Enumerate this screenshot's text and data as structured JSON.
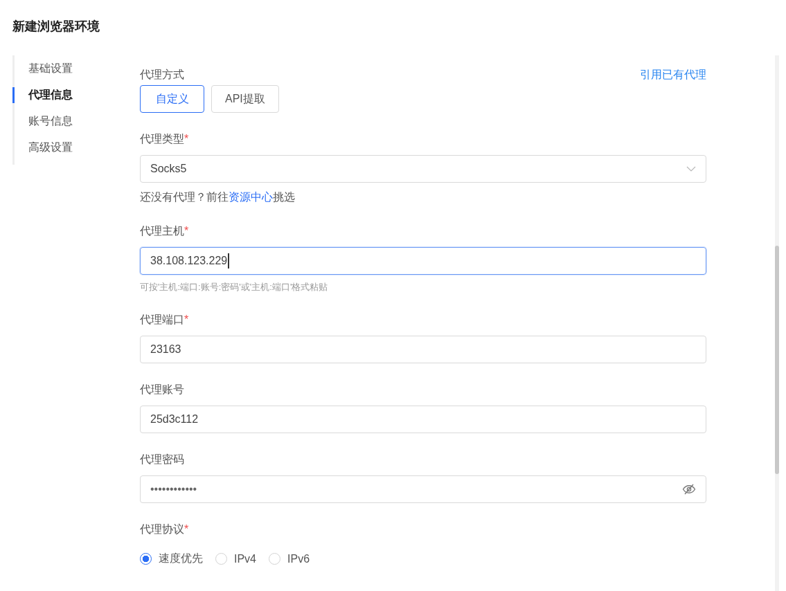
{
  "page_title": "新建浏览器环境",
  "sidebar": {
    "items": [
      {
        "label": "基础设置",
        "selected": false
      },
      {
        "label": "代理信息",
        "selected": true
      },
      {
        "label": "账号信息",
        "selected": false
      },
      {
        "label": "高级设置",
        "selected": false
      }
    ]
  },
  "proxy_mode": {
    "label": "代理方式",
    "link": "引用已有代理",
    "options": [
      {
        "label": "自定义",
        "selected": true
      },
      {
        "label": "API提取",
        "selected": false
      }
    ]
  },
  "fields": [
    {
      "kind": "select",
      "label": "代理类型",
      "required": true,
      "value": "Socks5",
      "focused": false,
      "hint_parts": [
        "还没有代理？前往",
        "资源中心",
        "挑选"
      ]
    },
    {
      "kind": "text",
      "label": "代理主机",
      "required": true,
      "value": "38.108.123.229",
      "focused": true,
      "note": "可按'主机:端口:账号:密码'或'主机:端口'格式粘贴"
    },
    {
      "kind": "text",
      "label": "代理端口",
      "required": true,
      "value": "23163",
      "focused": false
    },
    {
      "kind": "text",
      "label": "代理账号",
      "required": false,
      "value": "25d3c112",
      "focused": false
    },
    {
      "kind": "password",
      "label": "代理密码",
      "required": false,
      "value": "••••••••••••",
      "focused": false
    }
  ],
  "protocol": {
    "label": "代理协议",
    "required": true,
    "options": [
      {
        "label": "速度优先",
        "selected": true
      },
      {
        "label": "IPv4",
        "selected": false
      },
      {
        "label": "IPv6",
        "selected": false
      }
    ]
  },
  "required_mark": "*"
}
